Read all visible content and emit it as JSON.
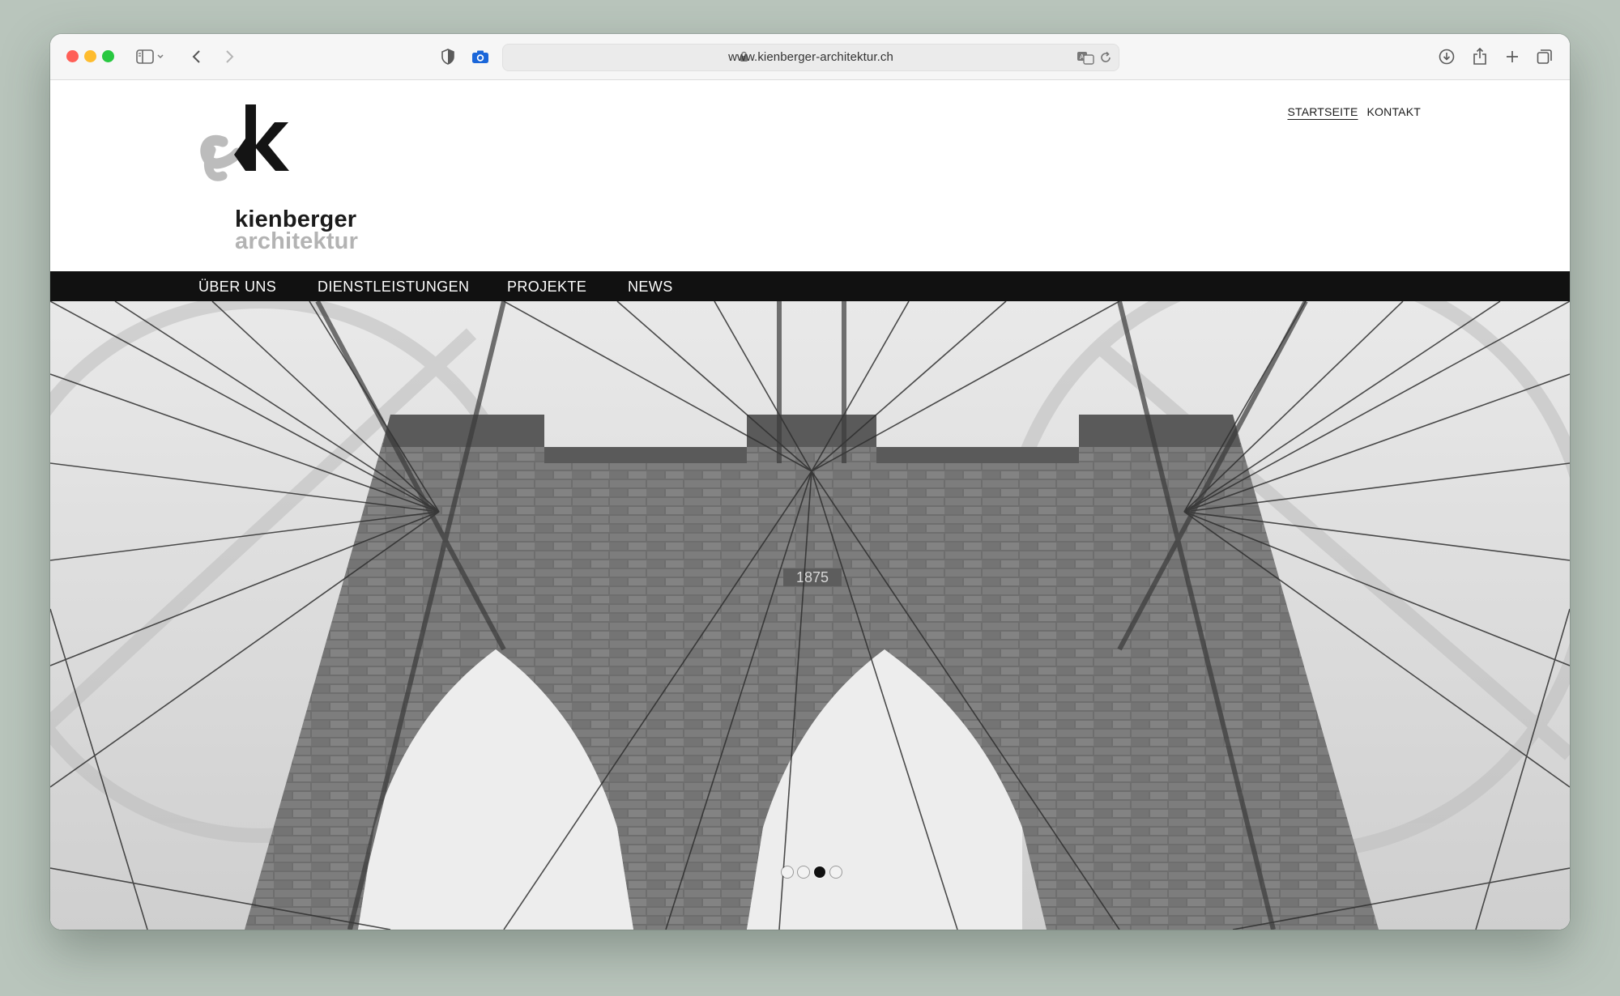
{
  "browser": {
    "url": "www.kienberger-architektur.ch",
    "traffic_lights": {
      "close": "#ff5f57",
      "minimize": "#febc2e",
      "zoom": "#28c840"
    },
    "accent": "#1a66d9"
  },
  "site": {
    "brand_line1": "kienberger",
    "brand_line2": "architektur",
    "top_nav": [
      "STARTSEITE",
      "KONTAKT"
    ],
    "main_nav": [
      "ÜBER UNS",
      "DIENSTLEISTUNGEN",
      "PROJEKTE",
      "NEWS"
    ],
    "hero": {
      "carved_year": "1875",
      "slider": {
        "count": 4,
        "active_index": 2
      }
    }
  }
}
